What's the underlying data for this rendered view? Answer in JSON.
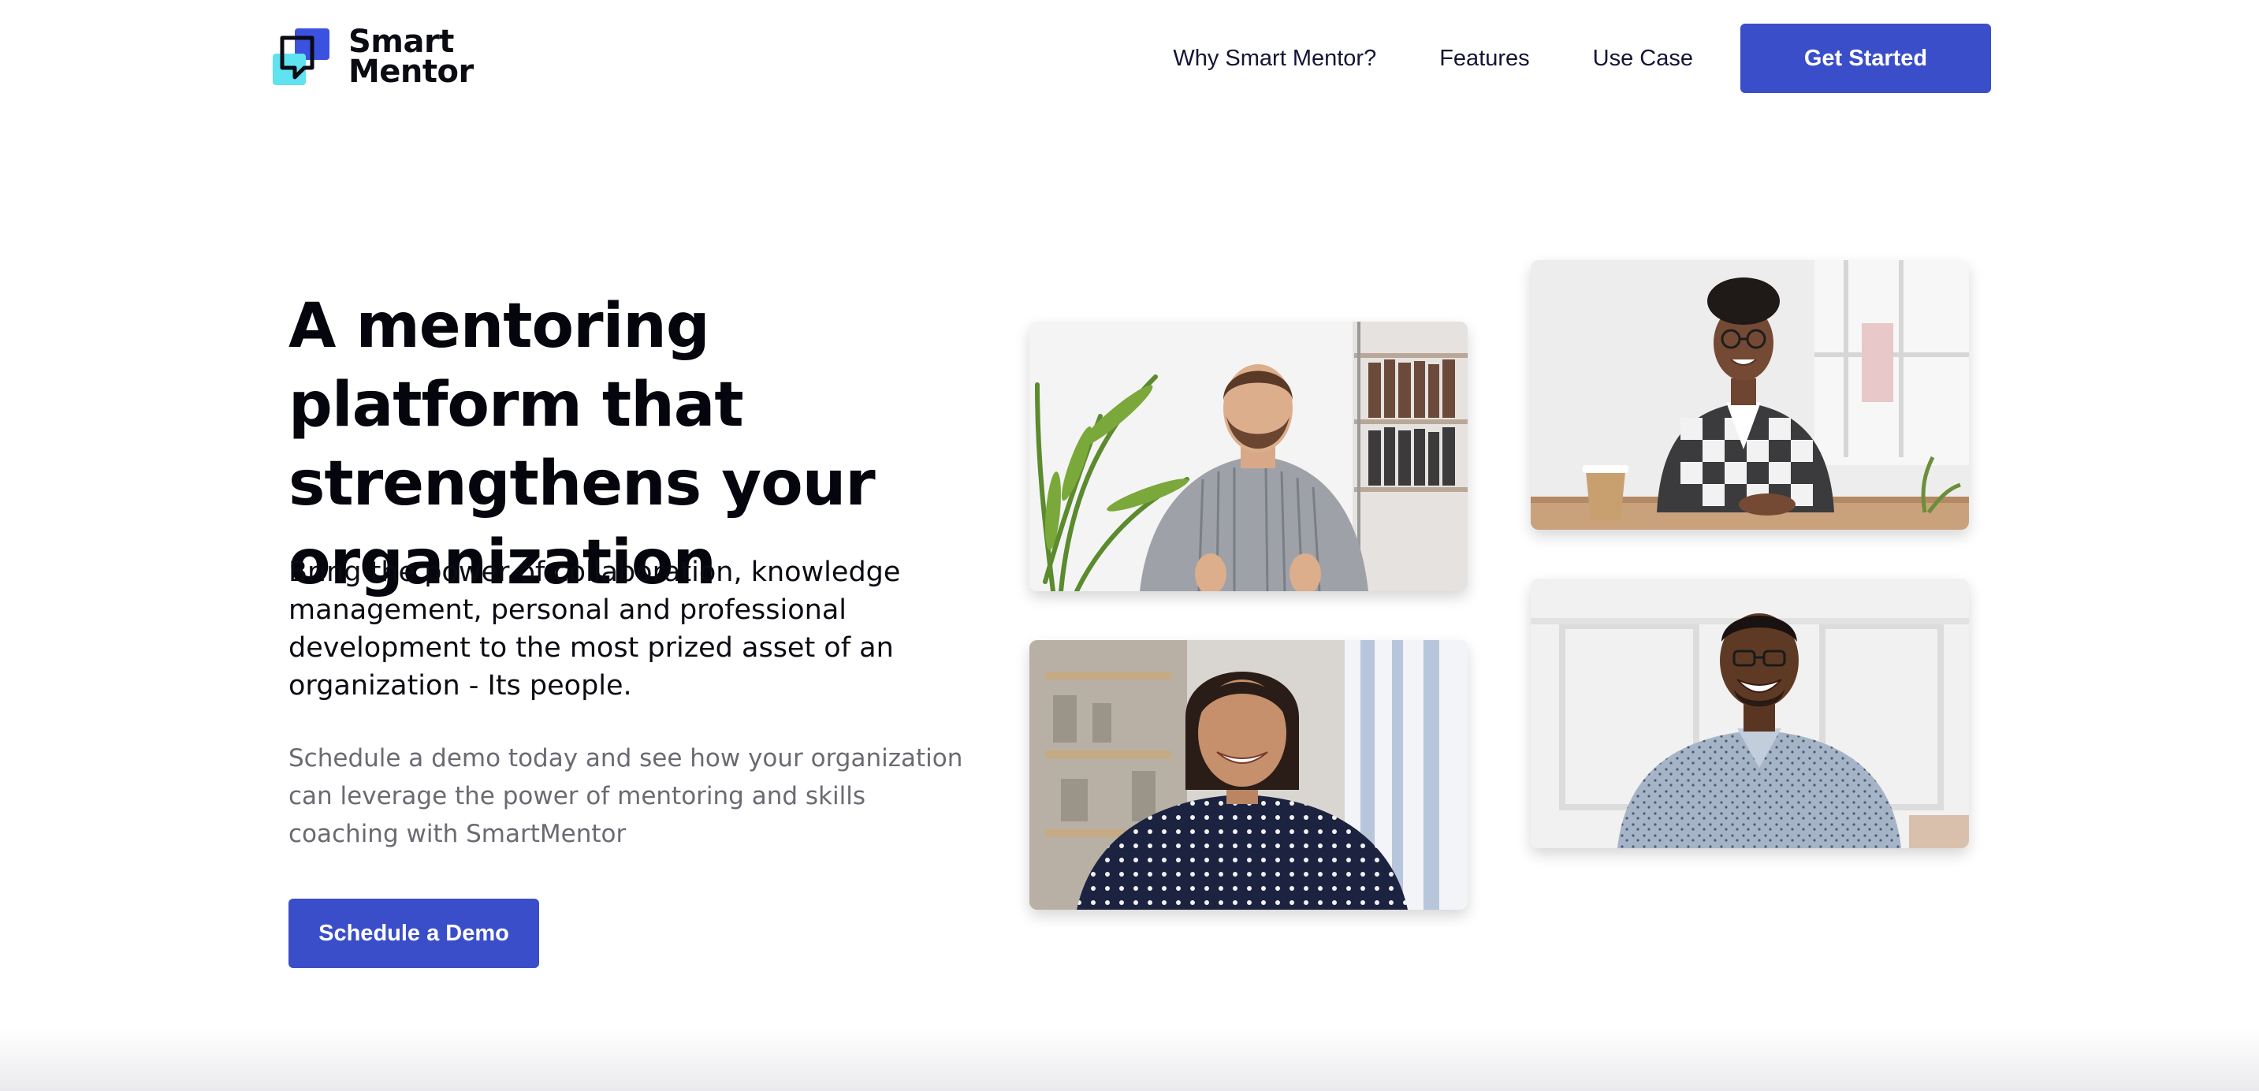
{
  "brand": {
    "line1": "Smart",
    "line2": "Mentor",
    "icon": "chat-bubbles-logo-icon",
    "colors": {
      "back": "#3b52e0",
      "front": "#5fe3f0",
      "outline": "#0b0b14"
    }
  },
  "nav": {
    "links": [
      {
        "label": "Why Smart Mentor?"
      },
      {
        "label": "Features"
      },
      {
        "label": "Use Case"
      }
    ],
    "cta_label": "Get Started"
  },
  "hero": {
    "title": "A mentoring platform that strengthens your organization",
    "subtitle": "Bring the power of collaboration, knowledge management, personal and professional development to the most prized asset of an organization - Its people.",
    "description": "Schedule a demo today and see how your organization can leverage the power of mentoring and skills coaching with SmartMentor",
    "cta_label": "Schedule a Demo"
  },
  "photos": [
    {
      "subject": "man-in-striped-shirt-photo"
    },
    {
      "subject": "woman-in-plaid-shirt-photo"
    },
    {
      "subject": "woman-in-polka-dot-blouse-photo"
    },
    {
      "subject": "man-in-patterned-shirt-photo"
    }
  ],
  "theme": {
    "accent": "#3a4ec9",
    "text": "#0b0b14",
    "muted_text": "#6a6a72",
    "background": "#ffffff"
  }
}
